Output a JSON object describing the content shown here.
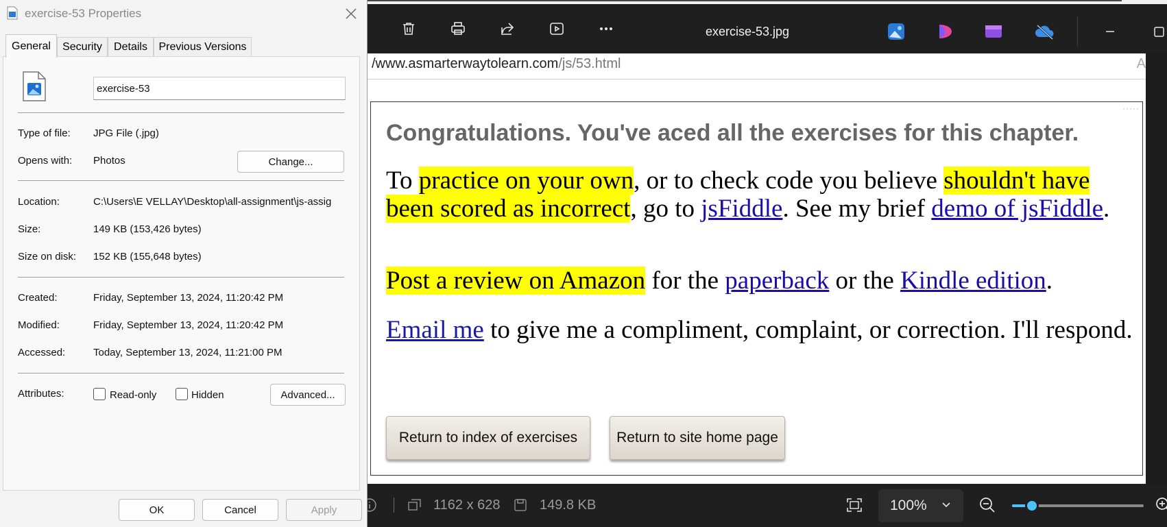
{
  "dialog": {
    "title": "exercise-53 Properties",
    "tabs": [
      "General",
      "Security",
      "Details",
      "Previous Versions"
    ],
    "file_name": "exercise-53",
    "type_label": "Type of file:",
    "type_value": "JPG File (.jpg)",
    "opens_label": "Opens with:",
    "opens_value": "Photos",
    "change_button": "Change...",
    "location_label": "Location:",
    "location_value": "C:\\Users\\E VELLAY\\Desktop\\all-assignment\\js-assig",
    "size_label": "Size:",
    "size_value": "149 KB (153,426 bytes)",
    "size_on_disk_label": "Size on disk:",
    "size_on_disk_value": "152 KB (155,648 bytes)",
    "created_label": "Created:",
    "created_value": "Friday, September 13, 2024, 11:20:42 PM",
    "modified_label": "Modified:",
    "modified_value": "Friday, September 13, 2024, 11:20:42 PM",
    "accessed_label": "Accessed:",
    "accessed_value": "Today, September 13, 2024, 11:21:00 PM",
    "attributes_label": "Attributes:",
    "readonly_label": "Read-only",
    "readonly_checked": false,
    "hidden_label": "Hidden",
    "hidden_checked": false,
    "advanced_button": "Advanced...",
    "ok_button": "OK",
    "cancel_button": "Cancel",
    "apply_button": "Apply"
  },
  "viewer": {
    "file_title": "exercise-53.jpg",
    "toolbar_icons": [
      "trash-icon",
      "print-icon",
      "share-icon",
      "slideshow-icon",
      "more-icon"
    ],
    "app_icons": [
      "photos-app-icon",
      "clipchamp-icon",
      "video-editor-icon",
      "onedrive-icon"
    ],
    "url_host": "/www.asmarterwaytolearn.com",
    "url_path": "/js/53.html",
    "url_right": "A",
    "page": {
      "heading": "Congratulations. You've aced all the exercises for this chapter.",
      "p1": {
        "t1": "To ",
        "h1": "practice on your own",
        "t2": ", or to check code you believe ",
        "h2": "shouldn't have been scored as incorrect",
        "t3": ", go to ",
        "l1": "jsFiddle",
        "t4": ". See my brief ",
        "l2": "demo of jsFiddle",
        "t5": "."
      },
      "p2": {
        "h1": "Post a review on Amazon",
        "t1": " for the ",
        "l1": "paperback",
        "t2": " or the ",
        "l2": "Kindle edition",
        "t3": "."
      },
      "p3": {
        "l1": "Email me",
        "t1": " to give me a compliment, complaint, or correction. I'll respond."
      },
      "button1": "Return to index of exercises",
      "button2": "Return to site home page"
    },
    "status": {
      "dimensions": "1162 x 628",
      "file_size": "149.8 KB",
      "zoom": "100%",
      "zoom_slider_fraction": 0.15
    },
    "colors": {
      "highlight": "#ffff00",
      "link": "#1a0dab",
      "accent": "#4cc2ff"
    }
  }
}
